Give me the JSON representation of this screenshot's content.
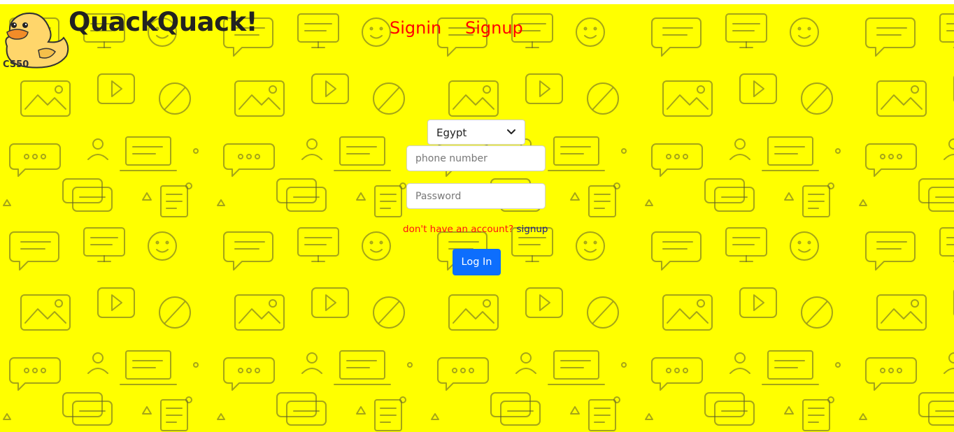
{
  "header": {
    "brand": "QuackQuack!",
    "logo_text": "CS50",
    "nav": {
      "signin": "Signin",
      "signup": "Signup"
    }
  },
  "login_form": {
    "country": {
      "selected": "Egypt"
    },
    "phone": {
      "placeholder": "phone number",
      "value": ""
    },
    "password": {
      "placeholder": "Password",
      "value": ""
    },
    "account_prompt": "don't have an account?",
    "signup_link": "signup",
    "submit_label": "Log In"
  },
  "colors": {
    "background": "#ffff00",
    "nav_link": "#ff0000",
    "prompt_text": "#ff1010",
    "signup_link": "#1a1a8a",
    "button": "#0d6efd"
  }
}
